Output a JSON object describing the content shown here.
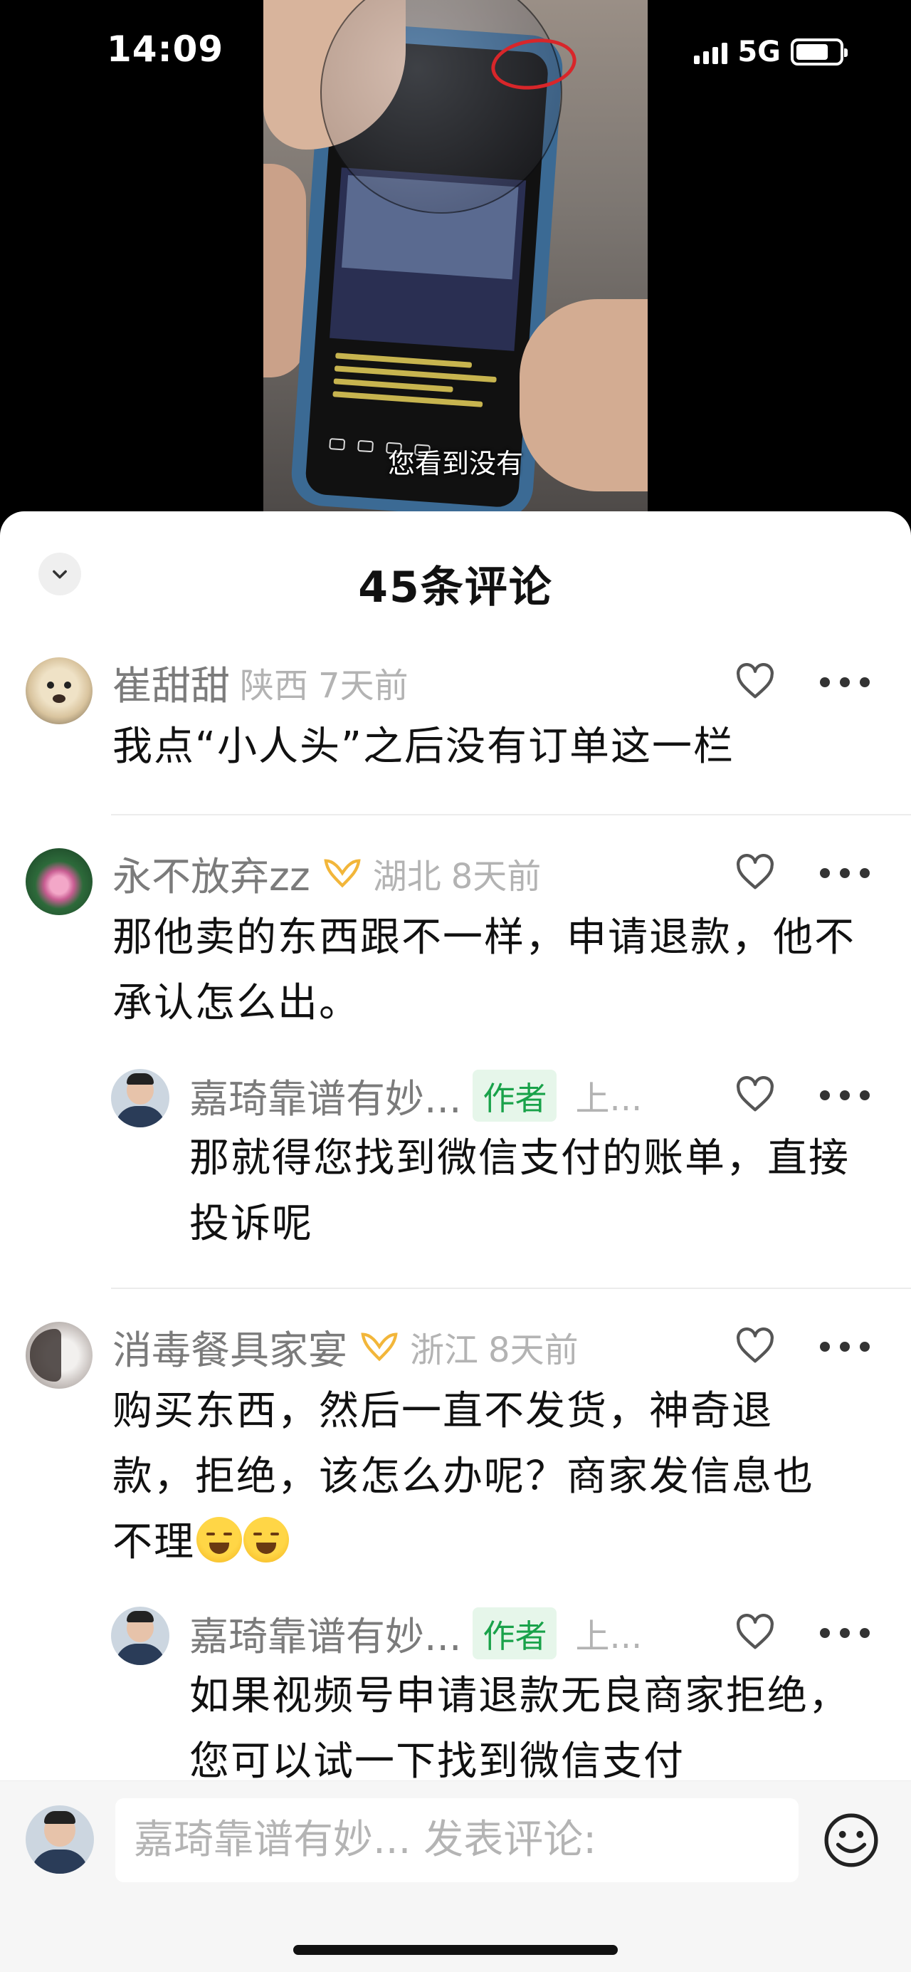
{
  "status_bar": {
    "time": "14:09",
    "network": "5G",
    "battery_percent": 75
  },
  "video": {
    "subtitle": "您看到没有"
  },
  "sheet": {
    "title": "45条评论"
  },
  "comments": [
    {
      "user": "崔甜甜",
      "region": "陕西",
      "time": "7天前",
      "text": "我点“小人头”之后没有订单这一栏",
      "vip": false,
      "avatar": "dog-avatar"
    },
    {
      "user": "永不放弃zz",
      "region": "湖北",
      "time": "8天前",
      "text": "那他卖的东西跟不一样，申请退款，他不承认怎么出。",
      "vip": true,
      "avatar": "lotus-avatar",
      "reply": {
        "user": "嘉琦靠谱有妙...",
        "badge": "作者",
        "time": "上...",
        "text": "那就得您找到微信支付的账单，直接投诉呢"
      }
    },
    {
      "user": "消毒餐具家宴",
      "region": "浙江",
      "time": "8天前",
      "text": "购买东西，然后一直不发货，神奇退款，拒绝，该怎么办呢？商家发信息也不理",
      "vip": true,
      "avatar": "doll-avatar",
      "emojis": 2,
      "reply": {
        "user": "嘉琦靠谱有妙...",
        "badge": "作者",
        "time": "上...",
        "text": "如果视频号申请退款无良商家拒绝，您可以试一下找到微信支付"
      }
    }
  ],
  "input": {
    "placeholder": "嘉琦靠谱有妙... 发表评论:"
  },
  "icons": {
    "collapse": "chevron-down-icon",
    "like": "heart-icon",
    "more": "more-dots-icon",
    "emoji": "smiley-icon"
  }
}
